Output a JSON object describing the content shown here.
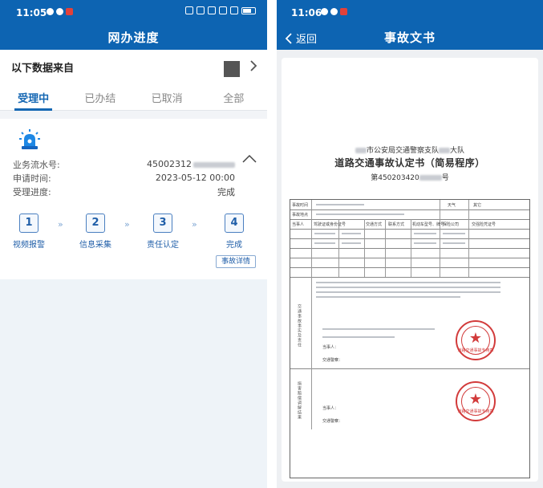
{
  "left": {
    "status": {
      "time": "11:05"
    },
    "header": {
      "title": "网办进度"
    },
    "source": {
      "label": "以下数据来自"
    },
    "tabs": [
      {
        "label": "受理中",
        "active": true
      },
      {
        "label": "已办结",
        "active": false
      },
      {
        "label": "已取消",
        "active": false
      },
      {
        "label": "全部",
        "active": false
      }
    ],
    "record": {
      "serial_label": "业务流水号:",
      "serial_value": "45002312",
      "apply_label": "申请时间:",
      "apply_value": "2023-05-12 00:00",
      "progress_label": "受理进度:",
      "progress_value": "完成"
    },
    "steps": [
      {
        "num": "1",
        "label": "视频报警"
      },
      {
        "num": "2",
        "label": "信息采集"
      },
      {
        "num": "3",
        "label": "责任认定"
      },
      {
        "num": "4",
        "label": "完成"
      }
    ],
    "arrows": [
      "»",
      "»",
      "»"
    ],
    "detail_button": "事故详情"
  },
  "right": {
    "status": {
      "time": "11:06"
    },
    "header": {
      "title": "事故文书",
      "back_label": "返回"
    },
    "document": {
      "org": "市公安局交通警察支队",
      "org_suffix": "大队",
      "title": "道路交通事故认定书（简易程序）",
      "number_prefix": "第450203420",
      "number_suffix": "号",
      "cells": {
        "weather_label": "天气",
        "weather_value": "其它",
        "party_label": "当事人",
        "license_label": "驾驶证或身份证号",
        "phone_label": "联系方式",
        "vehicle_label": "交通方式",
        "plate_label": "机动车型号、牌号",
        "insurance_label": "保险公司",
        "policy_label": "交强险凭证号",
        "section_facts": "交通事故事实及责任",
        "section_mediation": "损害赔偿调解结果",
        "party_sign": "当事人：",
        "officer_sign": "交通警察：",
        "stamp_text": "道路交通事故专用章"
      }
    }
  },
  "colors": {
    "header_blue": "#0d64b2",
    "accent_blue": "#1567b3",
    "stamp_red": "#d23b3b"
  }
}
